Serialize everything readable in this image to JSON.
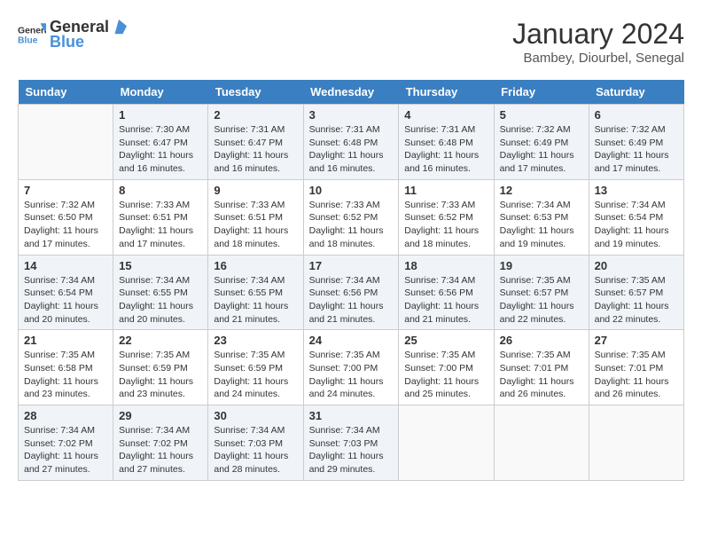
{
  "header": {
    "logo": {
      "text_general": "General",
      "text_blue": "Blue"
    },
    "title": "January 2024",
    "location": "Bambey, Diourbel, Senegal"
  },
  "days_of_week": [
    "Sunday",
    "Monday",
    "Tuesday",
    "Wednesday",
    "Thursday",
    "Friday",
    "Saturday"
  ],
  "weeks": [
    [
      {
        "day": "",
        "info": ""
      },
      {
        "day": "1",
        "info": "Sunrise: 7:30 AM\nSunset: 6:47 PM\nDaylight: 11 hours and 16 minutes."
      },
      {
        "day": "2",
        "info": "Sunrise: 7:31 AM\nSunset: 6:47 PM\nDaylight: 11 hours and 16 minutes."
      },
      {
        "day": "3",
        "info": "Sunrise: 7:31 AM\nSunset: 6:48 PM\nDaylight: 11 hours and 16 minutes."
      },
      {
        "day": "4",
        "info": "Sunrise: 7:31 AM\nSunset: 6:48 PM\nDaylight: 11 hours and 16 minutes."
      },
      {
        "day": "5",
        "info": "Sunrise: 7:32 AM\nSunset: 6:49 PM\nDaylight: 11 hours and 17 minutes."
      },
      {
        "day": "6",
        "info": "Sunrise: 7:32 AM\nSunset: 6:49 PM\nDaylight: 11 hours and 17 minutes."
      }
    ],
    [
      {
        "day": "7",
        "info": "Sunrise: 7:32 AM\nSunset: 6:50 PM\nDaylight: 11 hours and 17 minutes."
      },
      {
        "day": "8",
        "info": "Sunrise: 7:33 AM\nSunset: 6:51 PM\nDaylight: 11 hours and 17 minutes."
      },
      {
        "day": "9",
        "info": "Sunrise: 7:33 AM\nSunset: 6:51 PM\nDaylight: 11 hours and 18 minutes."
      },
      {
        "day": "10",
        "info": "Sunrise: 7:33 AM\nSunset: 6:52 PM\nDaylight: 11 hours and 18 minutes."
      },
      {
        "day": "11",
        "info": "Sunrise: 7:33 AM\nSunset: 6:52 PM\nDaylight: 11 hours and 18 minutes."
      },
      {
        "day": "12",
        "info": "Sunrise: 7:34 AM\nSunset: 6:53 PM\nDaylight: 11 hours and 19 minutes."
      },
      {
        "day": "13",
        "info": "Sunrise: 7:34 AM\nSunset: 6:54 PM\nDaylight: 11 hours and 19 minutes."
      }
    ],
    [
      {
        "day": "14",
        "info": "Sunrise: 7:34 AM\nSunset: 6:54 PM\nDaylight: 11 hours and 20 minutes."
      },
      {
        "day": "15",
        "info": "Sunrise: 7:34 AM\nSunset: 6:55 PM\nDaylight: 11 hours and 20 minutes."
      },
      {
        "day": "16",
        "info": "Sunrise: 7:34 AM\nSunset: 6:55 PM\nDaylight: 11 hours and 21 minutes."
      },
      {
        "day": "17",
        "info": "Sunrise: 7:34 AM\nSunset: 6:56 PM\nDaylight: 11 hours and 21 minutes."
      },
      {
        "day": "18",
        "info": "Sunrise: 7:34 AM\nSunset: 6:56 PM\nDaylight: 11 hours and 21 minutes."
      },
      {
        "day": "19",
        "info": "Sunrise: 7:35 AM\nSunset: 6:57 PM\nDaylight: 11 hours and 22 minutes."
      },
      {
        "day": "20",
        "info": "Sunrise: 7:35 AM\nSunset: 6:57 PM\nDaylight: 11 hours and 22 minutes."
      }
    ],
    [
      {
        "day": "21",
        "info": "Sunrise: 7:35 AM\nSunset: 6:58 PM\nDaylight: 11 hours and 23 minutes."
      },
      {
        "day": "22",
        "info": "Sunrise: 7:35 AM\nSunset: 6:59 PM\nDaylight: 11 hours and 23 minutes."
      },
      {
        "day": "23",
        "info": "Sunrise: 7:35 AM\nSunset: 6:59 PM\nDaylight: 11 hours and 24 minutes."
      },
      {
        "day": "24",
        "info": "Sunrise: 7:35 AM\nSunset: 7:00 PM\nDaylight: 11 hours and 24 minutes."
      },
      {
        "day": "25",
        "info": "Sunrise: 7:35 AM\nSunset: 7:00 PM\nDaylight: 11 hours and 25 minutes."
      },
      {
        "day": "26",
        "info": "Sunrise: 7:35 AM\nSunset: 7:01 PM\nDaylight: 11 hours and 26 minutes."
      },
      {
        "day": "27",
        "info": "Sunrise: 7:35 AM\nSunset: 7:01 PM\nDaylight: 11 hours and 26 minutes."
      }
    ],
    [
      {
        "day": "28",
        "info": "Sunrise: 7:34 AM\nSunset: 7:02 PM\nDaylight: 11 hours and 27 minutes."
      },
      {
        "day": "29",
        "info": "Sunrise: 7:34 AM\nSunset: 7:02 PM\nDaylight: 11 hours and 27 minutes."
      },
      {
        "day": "30",
        "info": "Sunrise: 7:34 AM\nSunset: 7:03 PM\nDaylight: 11 hours and 28 minutes."
      },
      {
        "day": "31",
        "info": "Sunrise: 7:34 AM\nSunset: 7:03 PM\nDaylight: 11 hours and 29 minutes."
      },
      {
        "day": "",
        "info": ""
      },
      {
        "day": "",
        "info": ""
      },
      {
        "day": "",
        "info": ""
      }
    ]
  ]
}
